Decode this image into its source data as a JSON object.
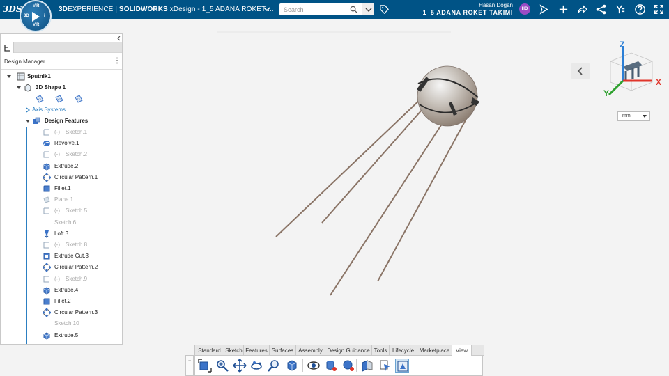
{
  "topbar": {
    "logo": "3DS",
    "compass_labels": {
      "top": "V,R",
      "left": "3D",
      "right": "i",
      "bottom": "V,R"
    },
    "brand_prefix": "3D",
    "brand_experience": "EXPERIENCE",
    "brand_sep": " | ",
    "brand_app": "SOLIDWORKS",
    "document_title": " xDesign - 1_5 ADANA ROKET ...",
    "search_placeholder": "Search",
    "user_name": "Hasan Doğan",
    "collab_space": "1_5 ADANA ROKET TAKIMI",
    "avatar_initials": "HD",
    "accent": "#005386"
  },
  "design_manager": {
    "title": "Design Manager",
    "tree": [
      {
        "label": "Sputnik1",
        "state": "normal",
        "icon": "part-icon",
        "twisty": "down",
        "bold": true
      },
      {
        "label": "3D Shape 1",
        "state": "normal",
        "icon": "shape-icon",
        "twisty": "down",
        "bold": true
      },
      {
        "label": "Axis Systems",
        "state": "link",
        "icon": "",
        "twisty": "right",
        "bold": false
      },
      {
        "label": "Design Features",
        "state": "normal",
        "icon": "features-icon",
        "twisty": "down",
        "bold": true
      },
      {
        "label": "Sketch.1",
        "state": "suppressed",
        "icon": "sketch-icon",
        "prefix": "(-)"
      },
      {
        "label": "Revolve.1",
        "state": "normal",
        "icon": "revolve-icon"
      },
      {
        "label": "Sketch.2",
        "state": "suppressed",
        "icon": "sketch-icon",
        "prefix": "(-)"
      },
      {
        "label": "Extrude.2",
        "state": "normal",
        "icon": "extrude-icon"
      },
      {
        "label": "Circular Pattern.1",
        "state": "normal",
        "icon": "circular-pattern-icon"
      },
      {
        "label": "Fillet.1",
        "state": "normal",
        "icon": "fillet-icon"
      },
      {
        "label": "Plane.1",
        "state": "suppressed",
        "icon": "plane-icon"
      },
      {
        "label": "Sketch.5",
        "state": "suppressed",
        "icon": "sketch-icon",
        "prefix": "(-)"
      },
      {
        "label": "Sketch.6",
        "state": "suppressed",
        "icon": ""
      },
      {
        "label": "Loft.3",
        "state": "normal",
        "icon": "loft-icon"
      },
      {
        "label": "Sketch.8",
        "state": "suppressed",
        "icon": "sketch-icon",
        "prefix": "(-)"
      },
      {
        "label": "Extrude Cut.3",
        "state": "normal",
        "icon": "extrude-cut-icon"
      },
      {
        "label": "Circular Pattern.2",
        "state": "normal",
        "icon": "circular-pattern-icon"
      },
      {
        "label": "Sketch.9",
        "state": "suppressed",
        "icon": "sketch-icon",
        "prefix": "(-)"
      },
      {
        "label": "Extrude.4",
        "state": "normal",
        "icon": "extrude-icon"
      },
      {
        "label": "Fillet.2",
        "state": "normal",
        "icon": "fillet-icon"
      },
      {
        "label": "Circular Pattern.3",
        "state": "normal",
        "icon": "circular-pattern-icon"
      },
      {
        "label": "Sketch.10",
        "state": "suppressed",
        "icon": ""
      },
      {
        "label": "Extrude.5",
        "state": "normal",
        "icon": "extrude-icon"
      }
    ],
    "plane_icons": [
      "xy-plane-icon",
      "yz-plane-icon",
      "zx-plane-icon"
    ]
  },
  "viewport": {
    "units": "mm",
    "axes": {
      "x": "X",
      "y": "Y",
      "z": "Z"
    },
    "axis_colors": {
      "x": "#e0352b",
      "y": "#2fa12f",
      "z": "#2b7fd6"
    }
  },
  "action_bar": {
    "tabs": [
      "Standard",
      "Sketch",
      "Features",
      "Surfaces",
      "Assembly",
      "Design Guidance",
      "Tools",
      "Lifecycle",
      "Marketplace",
      "View"
    ],
    "active_tab": "View",
    "tools": [
      "fit-all-icon",
      "zoom-icon",
      "pan-icon",
      "rotate-icon",
      "zoom-area-icon",
      "view-cube-icon",
      "hide-show-icon",
      "appearance-icon",
      "render-icon",
      "section-icon",
      "display-style-icon",
      "perspective-icon"
    ]
  }
}
